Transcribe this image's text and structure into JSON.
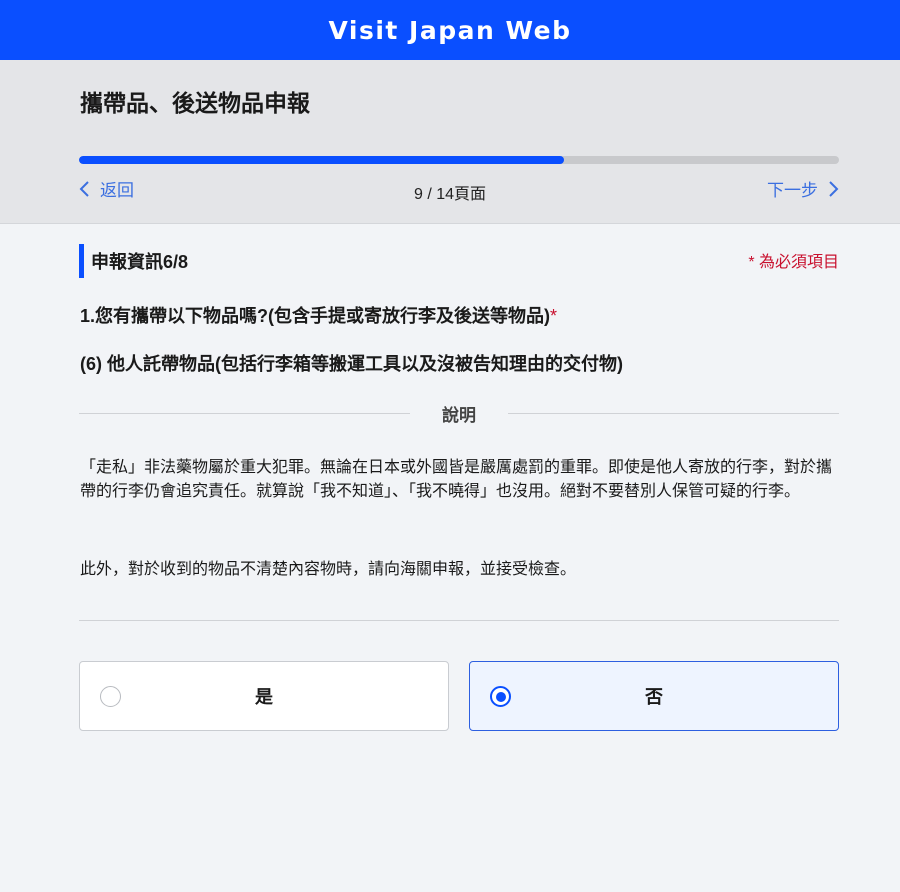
{
  "header": {
    "title": "Visit Japan Web"
  },
  "page": {
    "title": "攜帶品、後送物品申報",
    "progress_fraction": 0.638,
    "back_label": "返回",
    "next_label": "下一步",
    "page_indicator": "9 / 14頁面"
  },
  "section": {
    "title": "申報資訊6/8",
    "required_note": "* 為必須項目"
  },
  "question": {
    "text": "1.您有攜帶以下物品嗎?(包含手提或寄放行李及後送等物品)",
    "required_mark": "*",
    "sub_text": "(6) 他人託帶物品(包括行李箱等搬運工具以及沒被告知理由的交付物)"
  },
  "explanation": {
    "heading": "說明",
    "paragraph_1": "「走私」非法藥物屬於重大犯罪。無論在日本或外國皆是嚴厲處罰的重罪。即使是他人寄放的行李，對於攜帶的行李仍會追究責任。就算說「我不知道」、「我不曉得」也沒用。絕對不要替別人保管可疑的行李。",
    "paragraph_2": "此外，對於收到的物品不清楚內容物時，請向海關申報，並接受檢查。"
  },
  "options": {
    "yes_label": "是",
    "no_label": "否",
    "selected": "否"
  },
  "colors": {
    "brand_blue": "#0a4fff",
    "link_blue": "#3b6fe0",
    "required_red": "#c8102e"
  }
}
